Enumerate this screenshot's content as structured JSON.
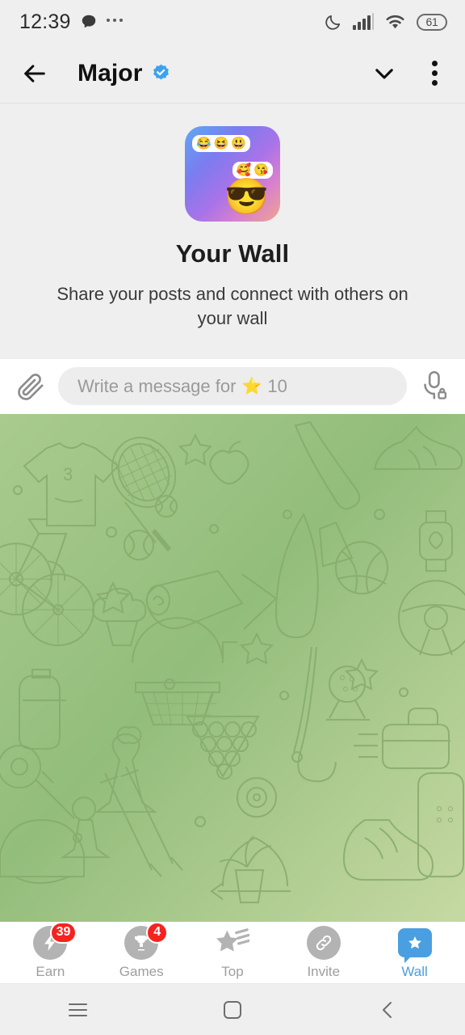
{
  "status_bar": {
    "time": "12:39",
    "message_icon": "chat-bubble-icon",
    "overflow_icon": "more-dots-icon",
    "dnd_icon": "moon-icon",
    "signal_icon": "cellular-signal-icon",
    "wifi_icon": "wifi-icon",
    "battery_level": "61"
  },
  "header": {
    "back_icon": "back-arrow-icon",
    "title": "Major",
    "verified_icon": "verified-badge-icon",
    "collapse_icon": "chevron-down-icon",
    "menu_icon": "kebab-menu-icon"
  },
  "empty_state": {
    "art_icon": "wall-emoji-art-icon",
    "bubble_one_emojis": [
      "😂",
      "😆",
      "😃"
    ],
    "bubble_two_emojis": [
      "🥰",
      "😘"
    ],
    "big_emoji": "😎",
    "title": "Your Wall",
    "subtitle": "Share your posts and connect with others on your wall"
  },
  "composer": {
    "attach_icon": "paperclip-icon",
    "placeholder_prefix": "Write a message for",
    "placeholder_star": "⭐",
    "placeholder_amount": "10",
    "mic_icon": "microphone-locked-icon"
  },
  "wallpaper": {
    "name": "sports-doodle-wallpaper",
    "gradient_from": "#a9cb8e",
    "gradient_to": "#8bb873",
    "line_color": "#86ab6c"
  },
  "bottom_nav": {
    "items": [
      {
        "label": "Earn",
        "icon": "lightning-bolt-icon",
        "badge": "39",
        "active": false
      },
      {
        "label": "Games",
        "icon": "trophy-icon",
        "badge": "4",
        "active": false
      },
      {
        "label": "Top",
        "icon": "shooting-star-icon",
        "badge": "",
        "active": false
      },
      {
        "label": "Invite",
        "icon": "link-chain-icon",
        "badge": "",
        "active": false
      },
      {
        "label": "Wall",
        "icon": "star-bubble-icon",
        "badge": "",
        "active": true
      }
    ],
    "active_color": "#4a9fe0",
    "inactive_color": "#9e9e9e",
    "badge_color": "#f5231f"
  },
  "android_nav": {
    "recents_icon": "recents-icon",
    "home_icon": "home-icon",
    "back_icon": "back-icon"
  }
}
